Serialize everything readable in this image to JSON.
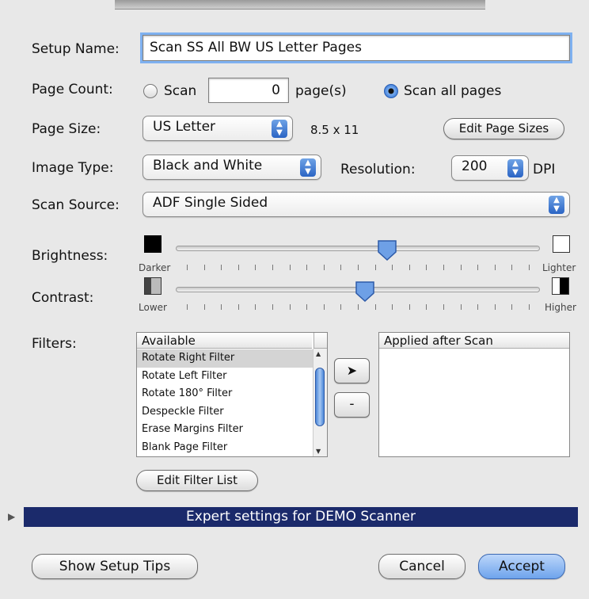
{
  "setup_name": {
    "label": "Setup Name:",
    "value": "Scan SS All BW US Letter Pages"
  },
  "page_count": {
    "label": "Page Count:",
    "scan_option": "Scan",
    "count_value": "0",
    "pages_suffix": "page(s)",
    "scan_all_option": "Scan all pages",
    "selected": "Scan all pages"
  },
  "page_size": {
    "label": "Page Size:",
    "selected": "US Letter",
    "dimensions": "8.5 x 11",
    "edit_button": "Edit Page Sizes"
  },
  "image_type": {
    "label": "Image Type:",
    "selected": "Black and White",
    "resolution_label": "Resolution:",
    "resolution_value": "200",
    "resolution_unit": "DPI"
  },
  "scan_source": {
    "label": "Scan Source:",
    "selected": "ADF Single Sided"
  },
  "brightness": {
    "label": "Brightness:",
    "min_label": "Darker",
    "max_label": "Lighter",
    "level": 0.58
  },
  "contrast": {
    "label": "Contrast:",
    "min_label": "Lower",
    "max_label": "Higher",
    "level": 0.52
  },
  "filters": {
    "label": "Filters:",
    "available_header": "Available",
    "available_items": [
      "Rotate Right Filter",
      "Rotate Left Filter",
      "Rotate 180° Filter",
      "Despeckle Filter",
      "Erase Margins Filter",
      "Blank Page Filter"
    ],
    "selected_item": "Rotate Right Filter",
    "applied_header": "Applied after Scan",
    "add_symbol": "➤",
    "remove_symbol": "-",
    "edit_button": "Edit Filter List"
  },
  "expert_settings": {
    "label": "Expert settings for DEMO Scanner"
  },
  "footer": {
    "tips_button": "Show Setup Tips",
    "cancel_button": "Cancel",
    "accept_button": "Accept"
  },
  "colors": {
    "accent": "#2f6fd1",
    "expert_bar": "#1b2a6b",
    "focus_ring": "#7fb1f0"
  }
}
